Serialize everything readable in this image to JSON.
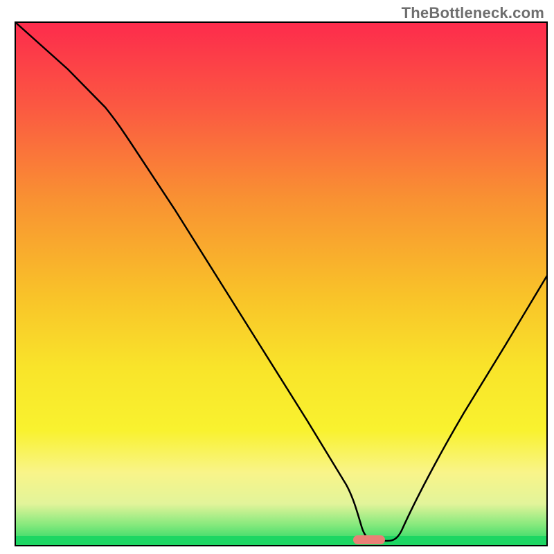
{
  "watermark": "TheBottleneck.com",
  "chart_data": {
    "type": "line",
    "title": "",
    "xlabel": "",
    "ylabel": "",
    "xlim": [
      0,
      100
    ],
    "ylim": [
      0,
      100
    ],
    "grid": false,
    "legend": false,
    "series": [
      {
        "name": "bottleneck-curve",
        "x": [
          0,
          5,
          10,
          15,
          20,
          25,
          30,
          35,
          40,
          45,
          50,
          55,
          60,
          62,
          65,
          68,
          70,
          75,
          80,
          85,
          90,
          95,
          100
        ],
        "y": [
          100,
          93,
          86,
          79,
          72,
          66,
          58,
          49,
          40,
          31,
          22,
          13,
          5,
          1,
          0,
          0,
          2,
          9,
          18,
          27,
          36,
          45,
          54
        ]
      }
    ],
    "marker": {
      "name": "optimal-range",
      "x_center": 65.5,
      "y": 0,
      "width_pct": 4.5
    },
    "gradient_colors": {
      "top": "#fd2b4c",
      "upper_mid": "#fb6d3e",
      "mid": "#fbcd2a",
      "lower_mid": "#f9f22f",
      "pale": "#f9f7a0",
      "green": "#1dd663"
    }
  }
}
